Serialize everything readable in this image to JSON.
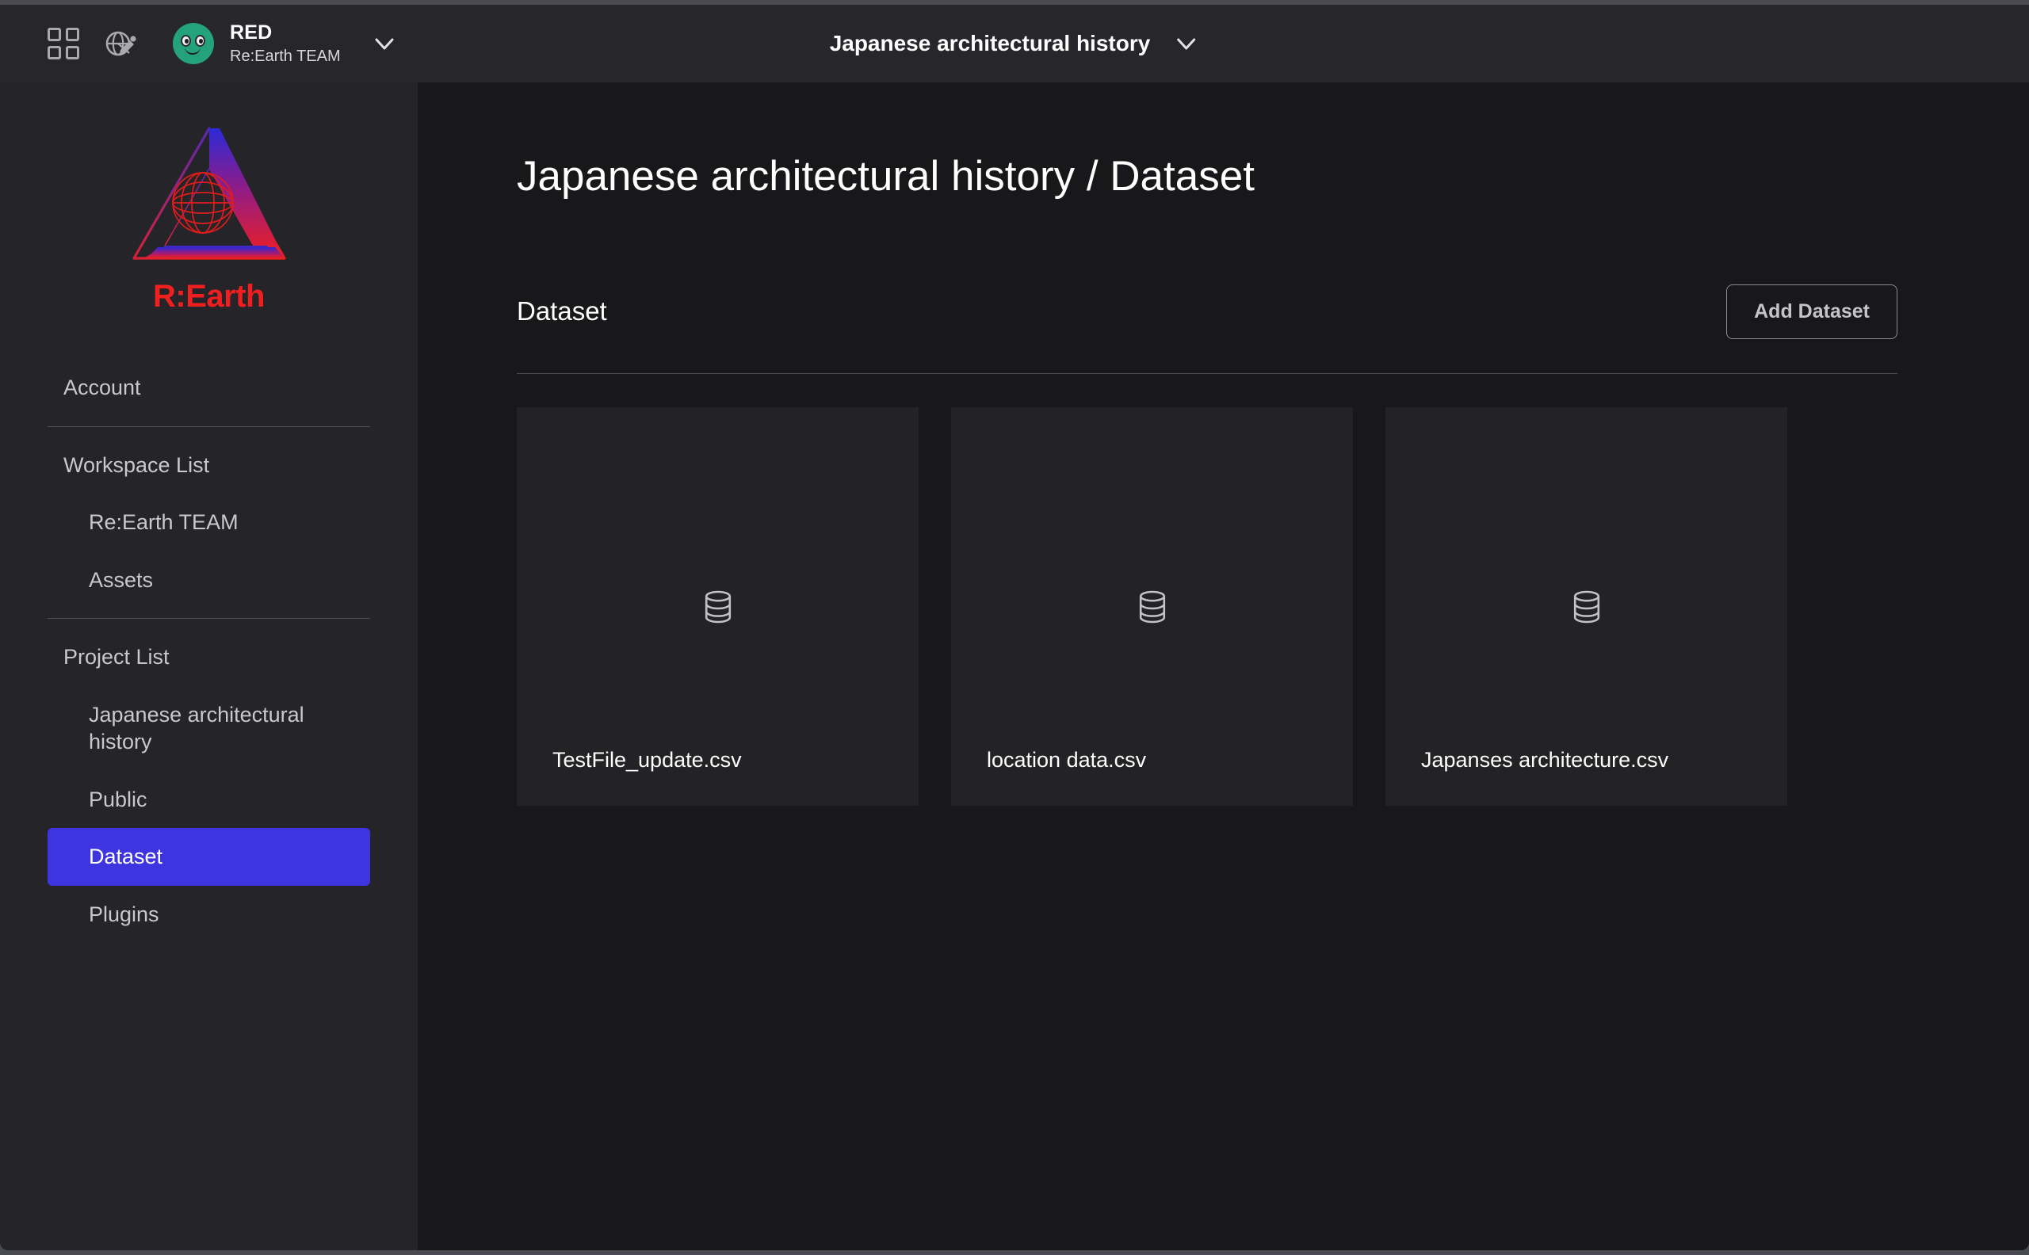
{
  "topbar": {
    "apps_icon": "grid-apps-icon",
    "earth_icon": "globe-edit-icon",
    "avatar_icon": "user-avatar",
    "workspace_name": "RED",
    "workspace_team": "Re:Earth TEAM",
    "workspace_chevron_icon": "chevron-down-icon",
    "project_title": "Japanese architectural history",
    "project_chevron_icon": "chevron-down-icon"
  },
  "sidebar": {
    "logo_text": "R:Earth",
    "logo_icon": "rearth-penrose-globe-logo",
    "logo_colors": {
      "top": "#2a2ad6",
      "bottom": "#f01f1f"
    },
    "items": [
      {
        "label": "Account",
        "level": "top",
        "active": false
      },
      {
        "label": "Workspace List",
        "level": "top",
        "active": false
      },
      {
        "label": "Re:Earth TEAM",
        "level": "sub",
        "active": false
      },
      {
        "label": "Assets",
        "level": "sub",
        "active": false
      },
      {
        "label": "Project List",
        "level": "top",
        "active": false
      },
      {
        "label": "Japanese architectural history",
        "level": "sub",
        "active": false
      },
      {
        "label": "Public",
        "level": "sub",
        "active": false
      },
      {
        "label": "Dataset",
        "level": "sub",
        "active": true
      },
      {
        "label": "Plugins",
        "level": "sub",
        "active": false
      }
    ],
    "active_color": "#3f35e0"
  },
  "main": {
    "breadcrumb": "Japanese architectural history / Dataset",
    "section_title": "Dataset",
    "add_button_label": "Add Dataset",
    "cards": [
      {
        "label": "TestFile_update.csv",
        "icon": "database-icon"
      },
      {
        "label": "location data.csv",
        "icon": "database-icon"
      },
      {
        "label": "Japanses architecture.csv",
        "icon": "database-icon"
      }
    ]
  }
}
